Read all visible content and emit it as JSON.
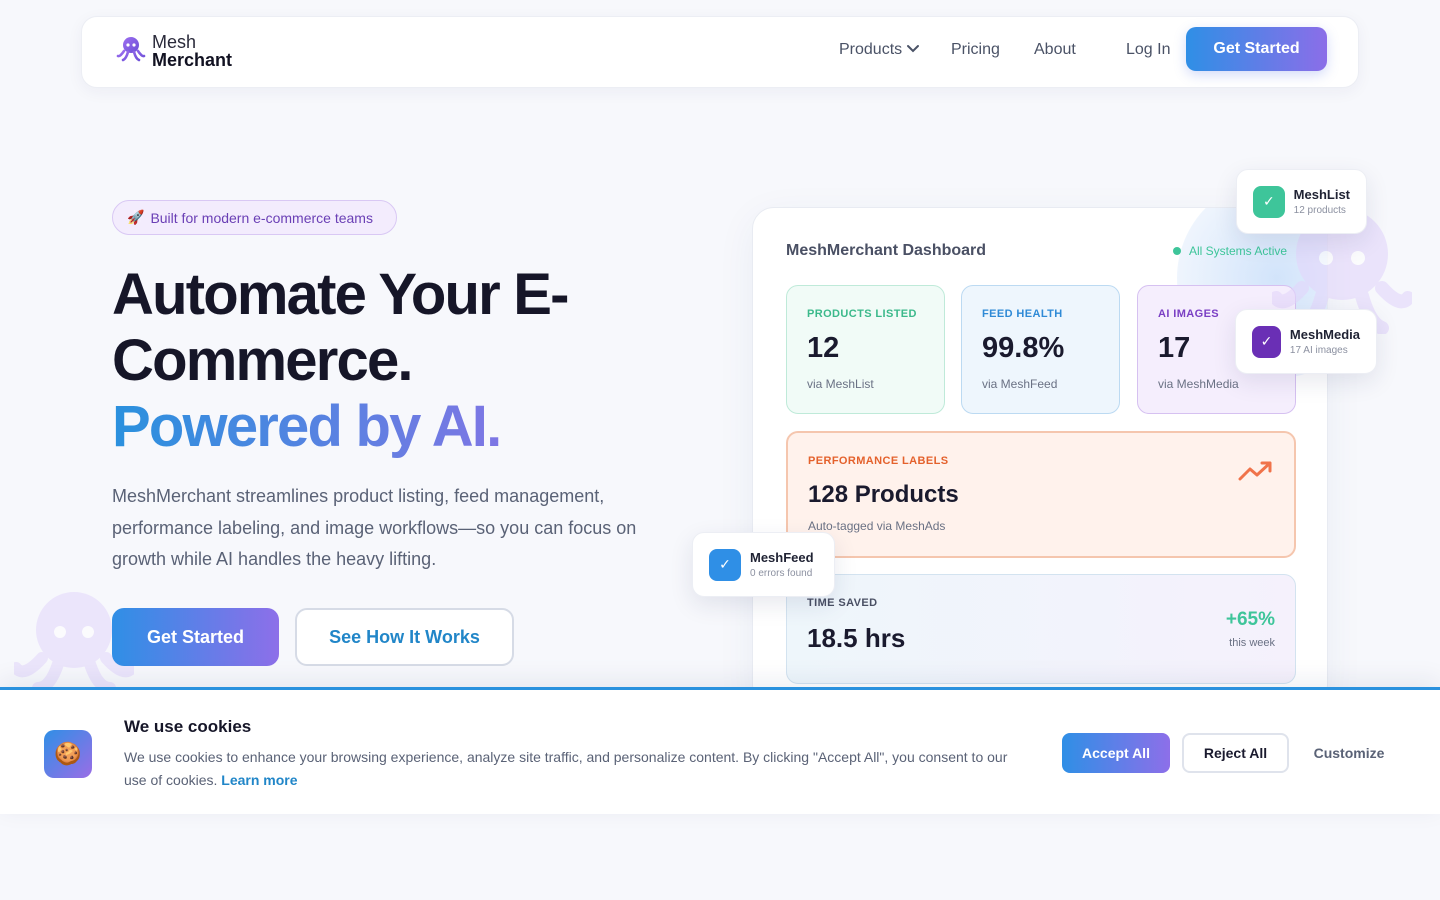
{
  "nav": {
    "logo_line1": "Mesh",
    "logo_line2": "Merchant",
    "products": "Products",
    "pricing": "Pricing",
    "about": "About",
    "login": "Log In",
    "cta": "Get Started"
  },
  "hero": {
    "badge_icon": "🚀",
    "badge": "Built for modern e-commerce teams",
    "title_line1": "Automate Your E-Commerce.",
    "title_line2": "Powered by AI.",
    "description": "MeshMerchant streamlines product listing, feed management, performance labeling, and image workflows—so you can focus on growth while AI handles the heavy lifting.",
    "primary_button": "Get Started",
    "secondary_button": "See How It Works"
  },
  "dashboard": {
    "title": "MeshMerchant Dashboard",
    "status": "All Systems Active",
    "stats": [
      {
        "label": "PRODUCTS LISTED",
        "value": "12",
        "sub": "via MeshList"
      },
      {
        "label": "FEED HEALTH",
        "value": "99.8%",
        "sub": "via MeshFeed"
      },
      {
        "label": "AI IMAGES",
        "value": "17",
        "sub": "via MeshMedia"
      }
    ],
    "performance": {
      "label": "PERFORMANCE LABELS",
      "value": "128 Products",
      "sub": "Auto-tagged via MeshAds"
    },
    "time_saved": {
      "label": "TIME SAVED",
      "value": "18.5 hrs",
      "change": "+65%",
      "change_sub": "this week"
    }
  },
  "floating": {
    "list": {
      "title": "MeshList",
      "sub": "12 products"
    },
    "media": {
      "title": "MeshMedia",
      "sub": "17 AI images"
    },
    "feed": {
      "title": "MeshFeed",
      "sub": "0 errors found"
    }
  },
  "cookie": {
    "icon": "🍪",
    "title": "We use cookies",
    "text": "We use cookies to enhance your browsing experience, analyze site traffic, and personalize content. By clicking \"Accept All\", you consent to our use of cookies.",
    "learn_more": "Learn more",
    "accept": "Accept All",
    "reject": "Reject All",
    "customize": "Customize"
  },
  "colors": {
    "accent_blue": "#2f8fe6",
    "accent_purple": "#8d6fe9",
    "success": "#3ec59a",
    "warning": "#e4612c"
  }
}
